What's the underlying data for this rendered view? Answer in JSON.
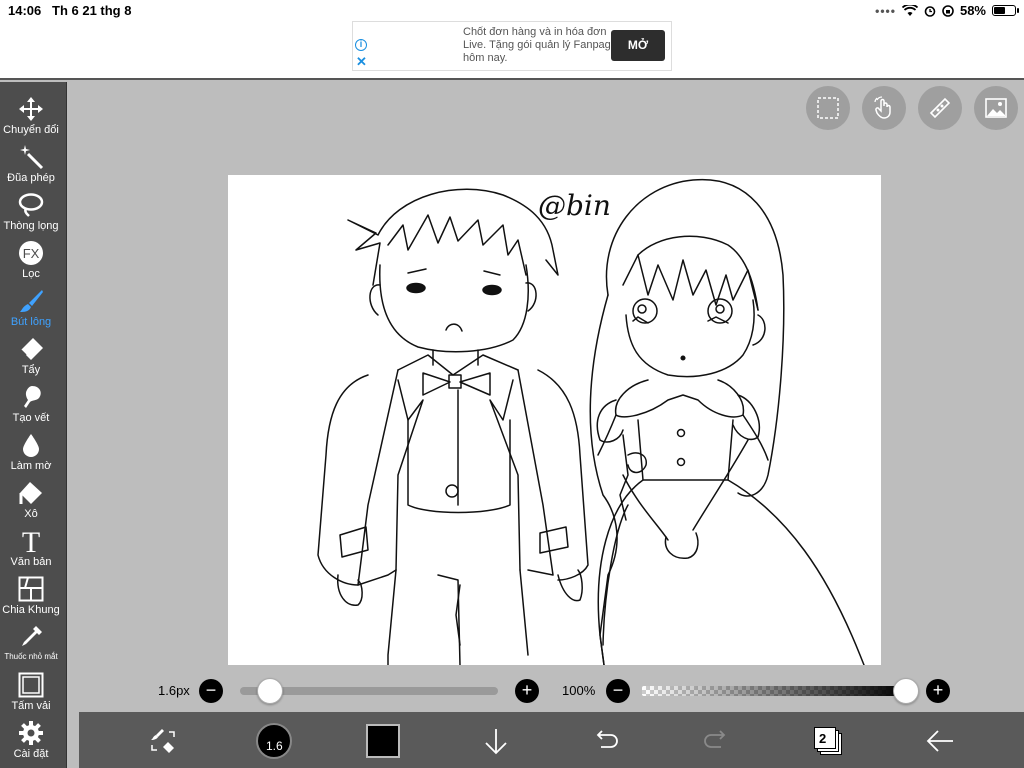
{
  "status": {
    "time": "14:06",
    "date": "Th 6 21 thg 8",
    "battery": "58%",
    "battery_level": 0.58
  },
  "ad": {
    "line1": "Chốt đơn hàng và in hóa đơn",
    "line2": "Live. Tặng gói quản lý Fanpag",
    "line3": "hôm nay.",
    "button": "MỞ"
  },
  "tools": [
    {
      "label": "Chuyển đổi",
      "icon": "move-icon"
    },
    {
      "label": "Đũa phép",
      "icon": "magic-wand-icon"
    },
    {
      "label": "Thòng lọng",
      "icon": "lasso-icon"
    },
    {
      "label": "Lọc",
      "icon": "fx-filter-icon",
      "glyph": "FX"
    },
    {
      "label": "Bút lông",
      "icon": "brush-icon",
      "active": true
    },
    {
      "label": "Tẩy",
      "icon": "eraser-icon"
    },
    {
      "label": "Tạo vết",
      "icon": "smudge-icon"
    },
    {
      "label": "Làm mờ",
      "icon": "blur-drop-icon"
    },
    {
      "label": "Xô",
      "icon": "bucket-icon"
    },
    {
      "label": "Văn bản",
      "icon": "text-icon",
      "glyph": "T"
    },
    {
      "label": "Chia Khung",
      "icon": "frame-divider-icon"
    },
    {
      "label": "Thuốc nhỏ mắt",
      "icon": "eyedropper-icon"
    },
    {
      "label": "Tấm vải",
      "icon": "canvas-icon"
    },
    {
      "label": "Cài đặt",
      "icon": "gear-icon"
    }
  ],
  "brush": {
    "size_label": "1.6px",
    "size_value": 1.6,
    "size_fraction": 0.06,
    "preview_size": "1.6"
  },
  "opacity": {
    "label": "100%",
    "value": 100
  },
  "layers": {
    "count": "2"
  },
  "signature": "@bin",
  "accent_color": "#3fa2ff"
}
